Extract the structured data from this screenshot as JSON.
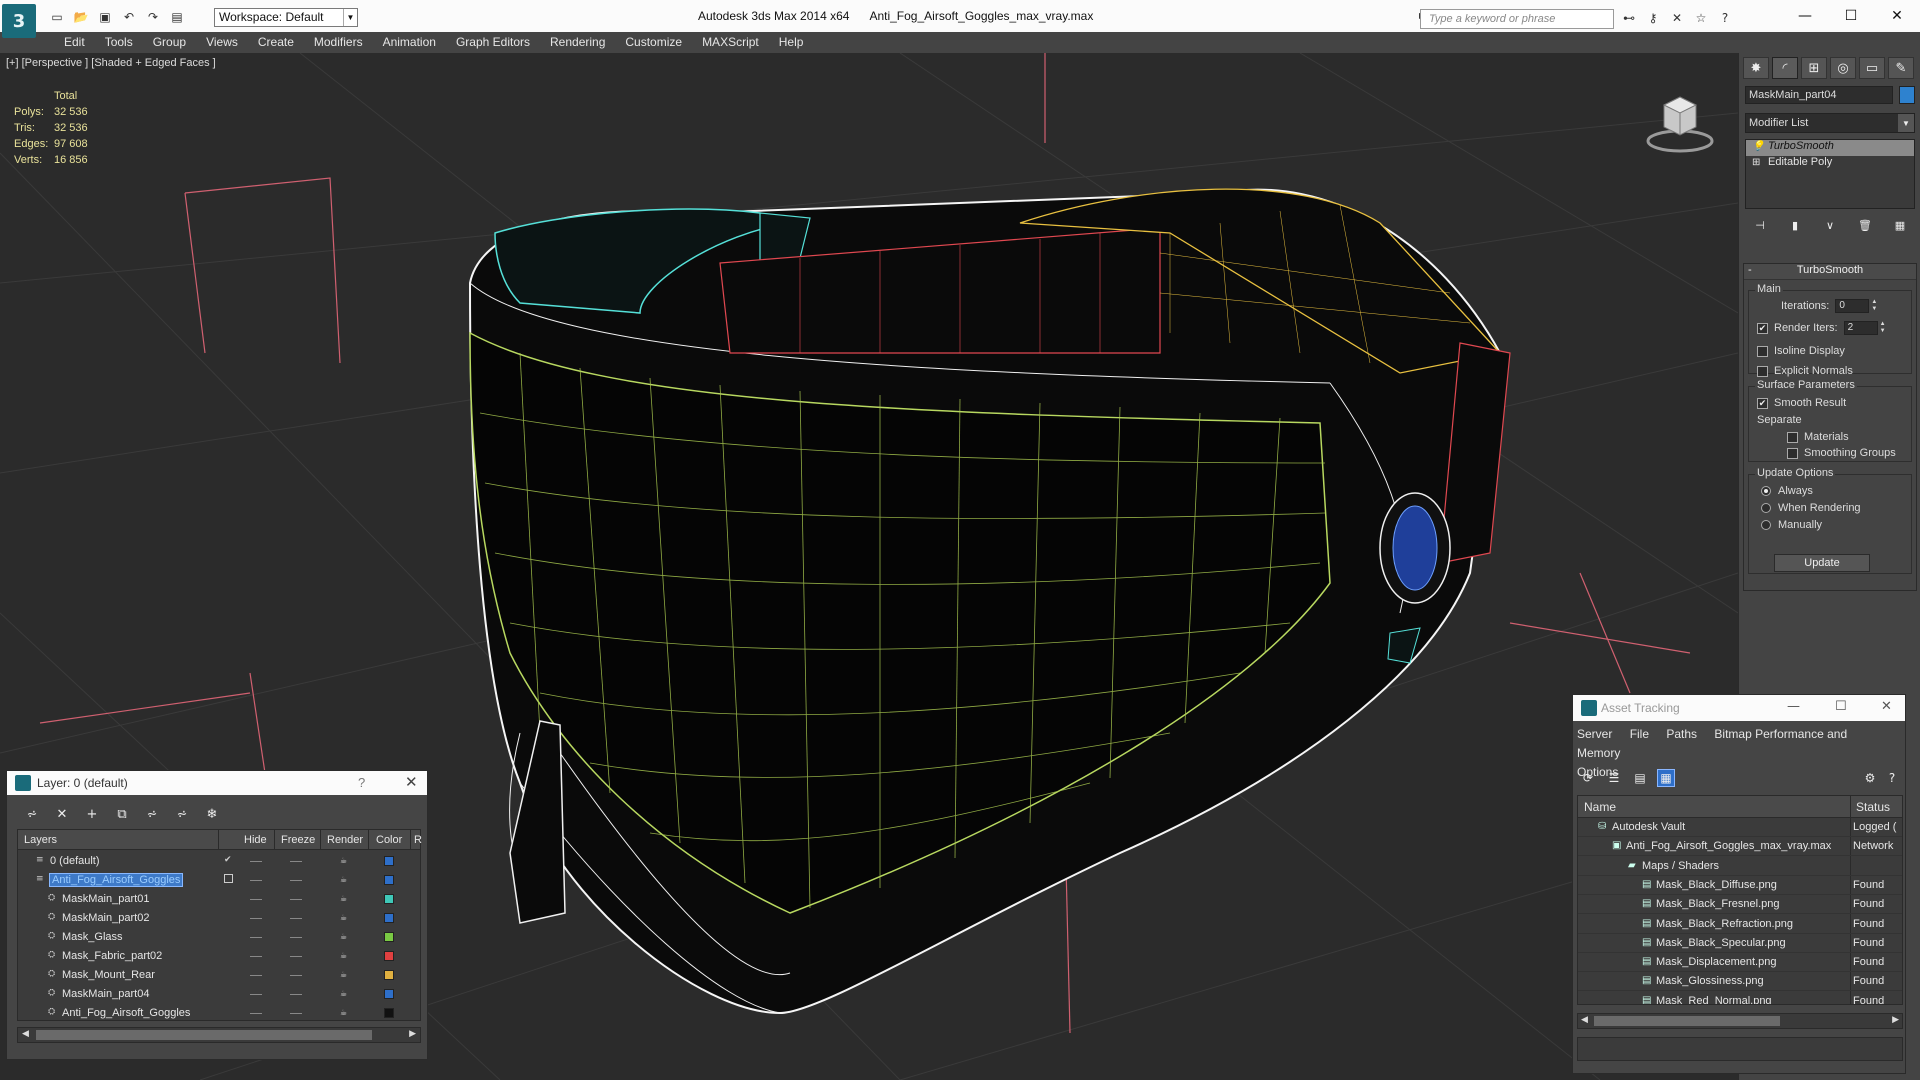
{
  "titlebar": {
    "workspace": "Workspace: Default",
    "app_title": "Autodesk 3ds Max  2014 x64",
    "file_title": "Anti_Fog_Airsoft_Goggles_max_vray.max",
    "search_placeholder": "Type a keyword or phrase",
    "app_logo": "3",
    "minimize": "—",
    "maximize": "☐",
    "close": "✕"
  },
  "menu": [
    "Edit",
    "Tools",
    "Group",
    "Views",
    "Create",
    "Modifiers",
    "Animation",
    "Graph Editors",
    "Rendering",
    "Customize",
    "MAXScript",
    "Help"
  ],
  "viewport": {
    "label": "[+] [Perspective ] [Shaded + Edged Faces ]",
    "stats": {
      "header": "Total",
      "rows": [
        {
          "label": "Polys:",
          "value": "32 536"
        },
        {
          "label": "Tris:",
          "value": "32 536"
        },
        {
          "label": "Edges:",
          "value": "97 608"
        },
        {
          "label": "Verts:",
          "value": "16 856"
        }
      ]
    }
  },
  "command_panel": {
    "object_name": "MaskMain_part04",
    "object_color": "#2e82cf",
    "modifier_list": "Modifier List",
    "stack": [
      "TurboSmooth",
      "Editable Poly"
    ],
    "rollout_title": "TurboSmooth",
    "main_group": "Main",
    "iterations_label": "Iterations:",
    "iterations_value": "0",
    "render_iters_label": "Render Iters:",
    "render_iters_value": "2",
    "isoline_label": "Isoline Display",
    "explicit_normals_label": "Explicit Normals",
    "surface_group": "Surface Parameters",
    "smooth_result_label": "Smooth Result",
    "separate_label": "Separate",
    "materials_label": "Materials",
    "smoothing_groups_label": "Smoothing Groups",
    "update_group": "Update Options",
    "always_label": "Always",
    "when_rendering_label": "When Rendering",
    "manually_label": "Manually",
    "update_button": "Update"
  },
  "layer_dialog": {
    "title": "Layer: 0 (default)",
    "help": "?",
    "close": "✕",
    "columns": [
      "Layers",
      "Hide",
      "Freeze",
      "Render",
      "Color",
      "R"
    ],
    "rows": [
      {
        "name": "0 (default)",
        "color": "#2e6fc9",
        "level": 1,
        "checked": true
      },
      {
        "name": "Anti_Fog_Airsoft_Goggles",
        "color": "#2e6fc9",
        "level": 1,
        "selected": true
      },
      {
        "name": "MaskMain_part01",
        "color": "#3fc8b8",
        "level": 2
      },
      {
        "name": "MaskMain_part02",
        "color": "#2e6fc9",
        "level": 2
      },
      {
        "name": "Mask_Glass",
        "color": "#7ac943",
        "level": 2
      },
      {
        "name": "Mask_Fabric_part02",
        "color": "#e04040",
        "level": 2
      },
      {
        "name": "Mask_Mount_Rear",
        "color": "#e0b040",
        "level": 2
      },
      {
        "name": "MaskMain_part04",
        "color": "#2e6fc9",
        "level": 2
      },
      {
        "name": "Anti_Fog_Airsoft_Goggles",
        "color": "#111111",
        "level": 2
      }
    ]
  },
  "asset_dialog": {
    "title": "Asset Tracking",
    "menu": [
      "Server",
      "File",
      "Paths",
      "Bitmap Performance and Memory",
      "Options"
    ],
    "columns": [
      "Name",
      "Status"
    ],
    "rows": [
      {
        "name": "Autodesk Vault",
        "status": "Logged (",
        "indent": 1,
        "icon": "⛁"
      },
      {
        "name": "Anti_Fog_Airsoft_Goggles_max_vray.max",
        "status": "Network",
        "indent": 2,
        "icon": "▣"
      },
      {
        "name": "Maps / Shaders",
        "status": "",
        "indent": 3,
        "icon": "▰"
      },
      {
        "name": "Mask_Black_Diffuse.png",
        "status": "Found",
        "indent": 4,
        "icon": "▤"
      },
      {
        "name": "Mask_Black_Fresnel.png",
        "status": "Found",
        "indent": 4,
        "icon": "▤"
      },
      {
        "name": "Mask_Black_Refraction.png",
        "status": "Found",
        "indent": 4,
        "icon": "▤"
      },
      {
        "name": "Mask_Black_Specular.png",
        "status": "Found",
        "indent": 4,
        "icon": "▤"
      },
      {
        "name": "Mask_Displacement.png",
        "status": "Found",
        "indent": 4,
        "icon": "▤"
      },
      {
        "name": "Mask_Glossiness.png",
        "status": "Found",
        "indent": 4,
        "icon": "▤"
      },
      {
        "name": "Mask_Red_Normal.png",
        "status": "Found",
        "indent": 4,
        "icon": "▤"
      }
    ]
  }
}
